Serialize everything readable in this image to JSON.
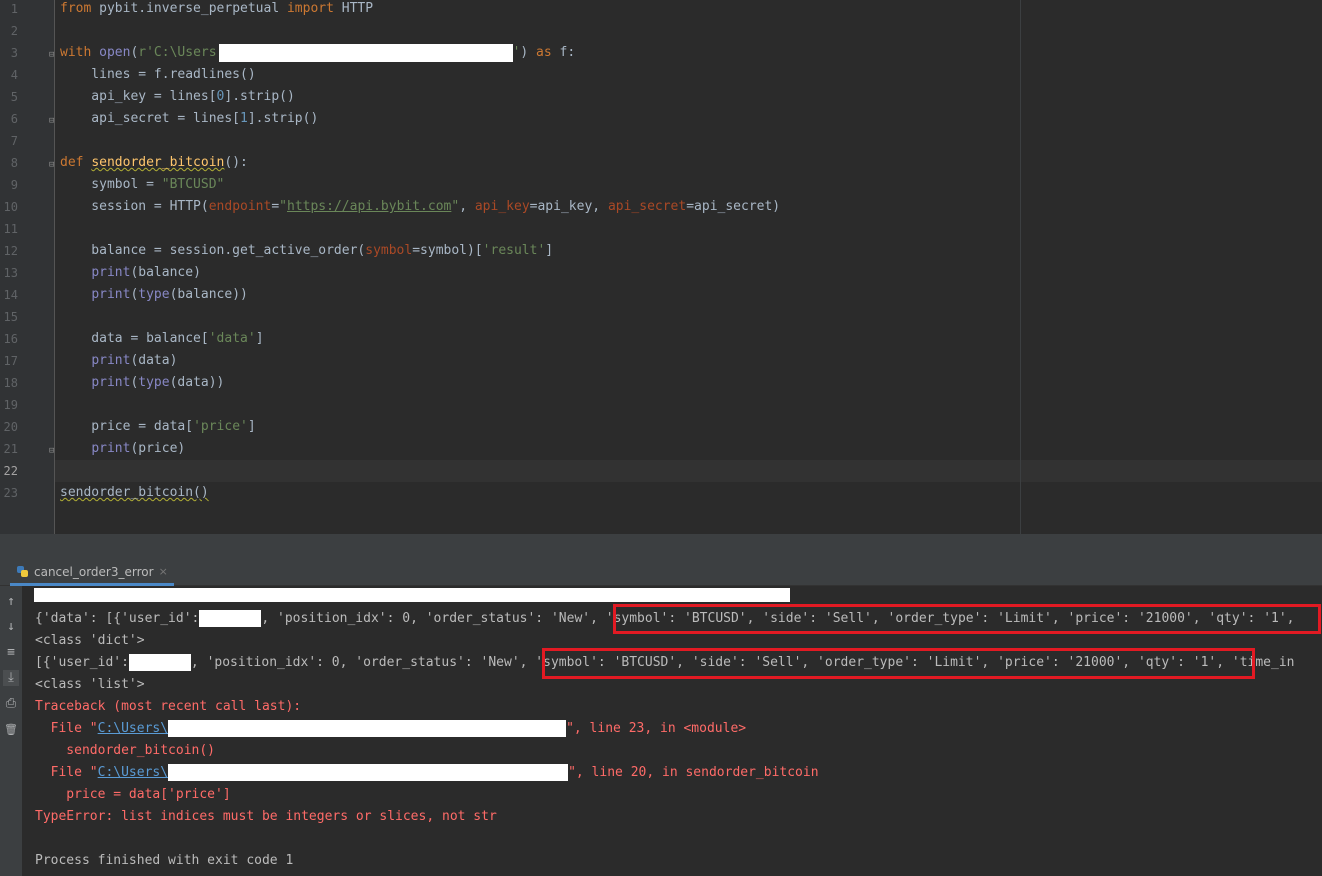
{
  "editor": {
    "line_numbers": [
      "1",
      "2",
      "3",
      "4",
      "5",
      "6",
      "7",
      "8",
      "9",
      "10",
      "11",
      "12",
      "13",
      "14",
      "15",
      "16",
      "17",
      "18",
      "19",
      "20",
      "21",
      "22",
      "23"
    ],
    "l1": {
      "from": "from",
      "module": " pybit.inverse_perpetual ",
      "import": "import",
      "name": " HTTP"
    },
    "l3": {
      "with": "with",
      "open": "open",
      "paren": "(",
      "str": "r'C:\\Users",
      "str_end": "'",
      ") as": ") ",
      "as": "as",
      "f": " f:"
    },
    "l4": "    lines = f.readlines()",
    "l5": {
      "a": "    api_key = lines[",
      "n": "0",
      "b": "].strip()"
    },
    "l6": {
      "a": "    api_secret = lines[",
      "n": "1",
      "b": "].strip()"
    },
    "l8": {
      "def": "def",
      "name": "sendorder_bitcoin",
      "rest": "():"
    },
    "l9": {
      "a": "    symbol = ",
      "s": "\"BTCUSD\""
    },
    "l10": {
      "a": "    session = HTTP(",
      "p1": "endpoint",
      "eq1": "=",
      "s1q": "\"",
      "s1": "https://api.bybit.com",
      "s1e": "\"",
      "c1": ", ",
      "p2": "api_key",
      "v2": "=api_key, ",
      "p3": "api_secret",
      "v3": "=api_secret)"
    },
    "l12": {
      "a": "    balance = session.get_active_order(",
      "p": "symbol",
      "b": "=symbol)[",
      "s": "'result'",
      "c": "]"
    },
    "l13": {
      "print": "print",
      "rest": "(balance)"
    },
    "l14": {
      "print": "print",
      "paren": "(",
      "type": "type",
      "rest": "(balance))"
    },
    "l16": {
      "a": "    data = balance[",
      "s": "'data'",
      "c": "]"
    },
    "l17": {
      "print": "print",
      "rest": "(data)"
    },
    "l18": {
      "print": "print",
      "paren": "(",
      "type": "type",
      "rest": "(data))"
    },
    "l20": {
      "a": "    price = data[",
      "s": "'price'",
      "c": "]"
    },
    "l21": {
      "print": "print",
      "rest": "(price)"
    },
    "l23": "sendorder_bitcoin()"
  },
  "run_panel": {
    "tab_label": "cancel_order3_error",
    "tab_close": "×"
  },
  "toolbar": {
    "up_icon": "↑",
    "down_icon": "↓",
    "wrap_icon": "≡",
    "scroll_icon": "⤓",
    "print_icon": "⎙",
    "trash_icon": "🗑"
  },
  "console": {
    "line1": {
      "a": "{'data': [{'user_id':",
      "b": ", 'position_idx': 0, 'order_status': 'New', ",
      "c": "'symbol': 'BTCUSD', 'side': 'Sell', 'order_type': 'Limit', 'price': '21000', 'qty': '1',"
    },
    "line2": "<class 'dict'>",
    "line3": {
      "a": "[{'user_id':",
      "b": ", 'position_idx': 0, 'order_status': 'New', ",
      "c": "'symbol': 'BTCUSD', 'side': 'Sell', 'order_type': 'Limit', 'price': '21000', 'qty': '1',",
      "d": " 'time_in"
    },
    "line4": "<class 'list'>",
    "traceback": "Traceback (most recent call last):",
    "file1": {
      "a": "  File \"",
      "link": "C:\\Users\\",
      "b": "\", line 23, in <module>"
    },
    "call1": "    sendorder_bitcoin()",
    "file2": {
      "a": "  File \"",
      "link": "C:\\Users\\",
      "b": "\", line 20, in sendorder_bitcoin"
    },
    "call2": "    price = data['price']",
    "error": "TypeError: list indices must be integers or slices, not str",
    "exit": "Process finished with exit code 1"
  },
  "colors": {
    "highlight_box": "#e21a23",
    "keyword": "#cc7832",
    "string": "#6a8759",
    "error": "#ff6b68"
  }
}
